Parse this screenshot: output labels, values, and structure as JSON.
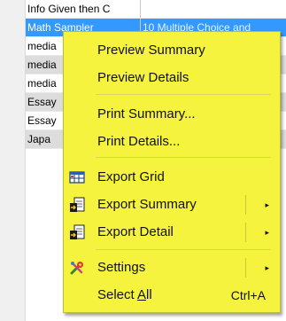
{
  "grid": {
    "rows": [
      {
        "c1": "Info Given then C",
        "c2": ""
      },
      {
        "c1": "Math Sampler",
        "c2": "10 Multiple Choice and"
      },
      {
        "c1": "media",
        "c2": ""
      },
      {
        "c1": "media",
        "c2": ""
      },
      {
        "c1": "media",
        "c2": ""
      },
      {
        "c1": "Essay",
        "c2": ""
      },
      {
        "c1": "Essay",
        "c2": ""
      },
      {
        "c1": "Japa",
        "c2": ""
      }
    ]
  },
  "menu": {
    "preview_summary": "Preview Summary",
    "preview_details": "Preview Details",
    "print_summary": "Print Summary...",
    "print_details": "Print Details...",
    "export_grid": "Export Grid",
    "export_summary": "Export Summary",
    "export_detail": "Export Detail",
    "settings": "Settings",
    "select_all_prefix": "Select ",
    "select_all_underline": "A",
    "select_all_suffix": "ll",
    "select_all_shortcut": "Ctrl+A"
  },
  "icons": {
    "export_grid": "grid-export-icon",
    "export_summary": "document-export-icon",
    "export_detail": "document-export-icon",
    "settings": "tools-icon",
    "submenu_arrow": "▸"
  },
  "colors": {
    "menu_bg": "#f6f33f",
    "selected_row": "#3399ff",
    "gray_row": "#dcdcdc"
  }
}
